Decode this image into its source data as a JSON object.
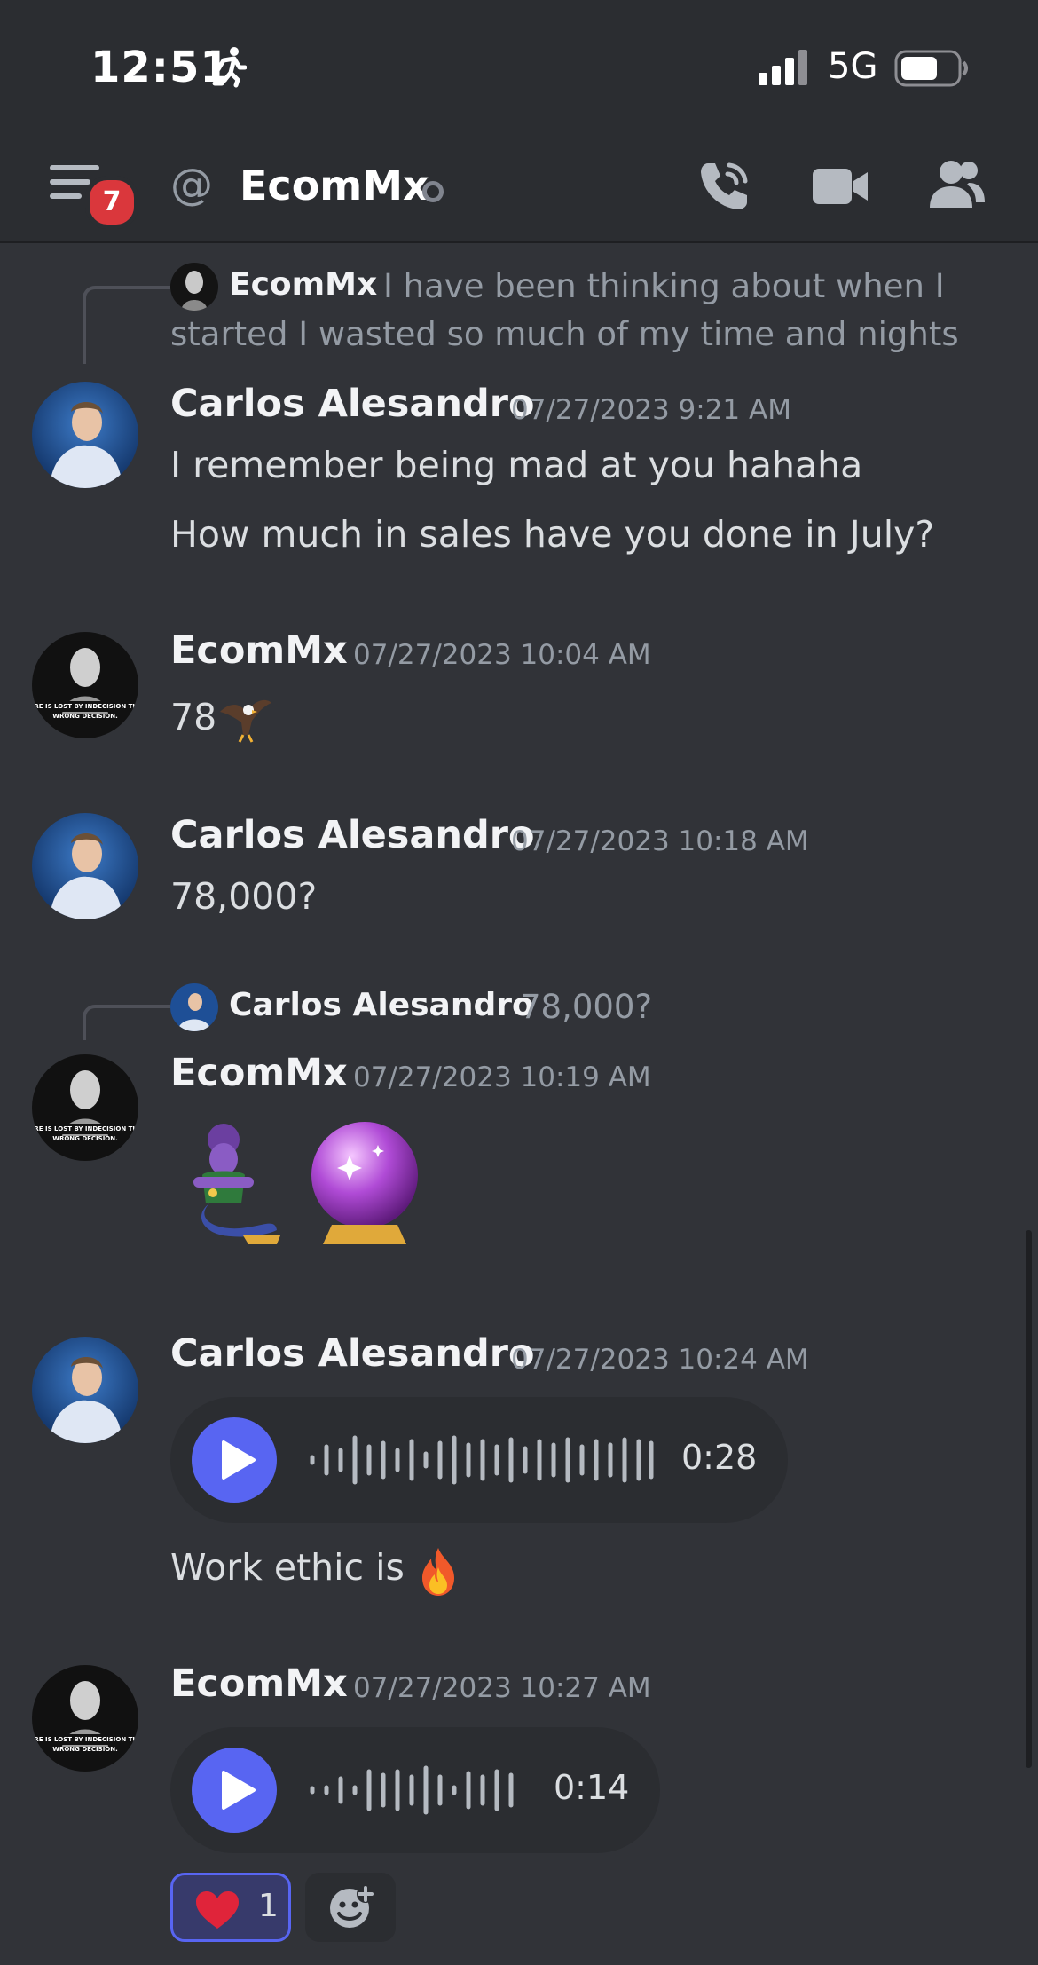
{
  "status": {
    "time": "12:51",
    "network": "5G"
  },
  "header": {
    "badge_count": "7",
    "at_symbol": "@",
    "title": "EcomMx"
  },
  "messages": [
    {
      "reply": {
        "author": "EcomMx",
        "text": "I have been thinking about when I started I wasted so much of my time and nights wi..."
      },
      "author": "Carlos Alesandro",
      "timestamp": "07/27/2023 9:21 AM",
      "lines": [
        "I remember being mad at you hahaha",
        "How much in sales have you done in July?"
      ]
    },
    {
      "author": "EcomMx",
      "timestamp": "07/27/2023 10:04 AM",
      "text": "78"
    },
    {
      "author": "Carlos Alesandro",
      "timestamp": "07/27/2023 10:18 AM",
      "text": "78,000?"
    },
    {
      "reply": {
        "author": "Carlos Alesandro",
        "text": "78,000?"
      },
      "author": "EcomMx",
      "timestamp": "07/27/2023 10:19 AM"
    },
    {
      "author": "Carlos Alesandro",
      "timestamp": "07/27/2023 10:24 AM",
      "voice_duration": "0:28",
      "text": "Work ethic is"
    },
    {
      "author": "EcomMx",
      "timestamp": "07/27/2023 10:27 AM",
      "voice_duration": "0:14",
      "reaction": {
        "emoji": "heart",
        "count": "1"
      }
    }
  ],
  "avatars": {
    "carlos": "portrait-photo",
    "ecommx": "statue-avatar"
  },
  "avatar_caption": "MORE IS LOST BY INDECISION THAN WRONG DECISION."
}
